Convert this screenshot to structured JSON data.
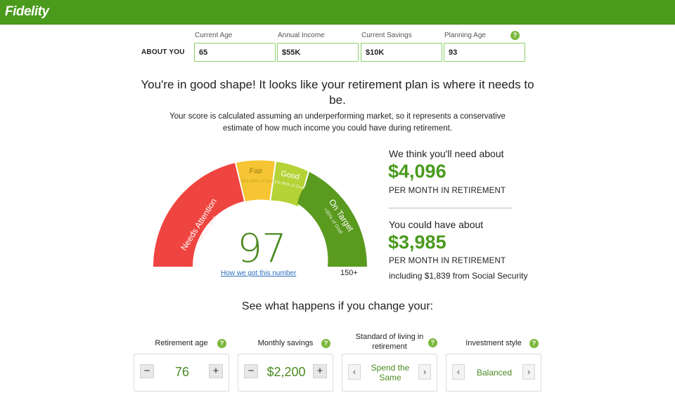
{
  "header": {
    "logo_text": "Fidelity",
    "brand_color": "#4a9a1c"
  },
  "about": {
    "label": "ABOUT YOU",
    "fields": [
      {
        "label": "Current Age",
        "value": "65"
      },
      {
        "label": "Annual Income",
        "value": "$55K"
      },
      {
        "label": "Current Savings",
        "value": "$10K"
      },
      {
        "label": "Planning Age",
        "value": "93"
      }
    ],
    "help_glyph": "?"
  },
  "result": {
    "headline": "You're in good shape! It looks like your retirement plan is where it needs to be.",
    "subtext": "Your score is calculated assuming an underperforming market, so it represents a conservative estimate of how much income you could have during retirement."
  },
  "gauge": {
    "score": "97",
    "link": "How we got this number",
    "max_label": "150+",
    "segments": [
      {
        "title": "Needs Attention",
        "range": "<65% of Goal",
        "color": "#ef4540"
      },
      {
        "title": "Fair",
        "range": "65%-80% of Goal",
        "color": "#f6c533"
      },
      {
        "title": "Good",
        "range": "81%-95% of Goal",
        "color": "#b5d336"
      },
      {
        "title": "On Target",
        "range": ">95% of Goal",
        "color": "#5a9a1e"
      }
    ]
  },
  "need": {
    "intro": "We think you'll need about",
    "amount": "$4,096",
    "sub": "PER MONTH IN RETIREMENT"
  },
  "have": {
    "intro": "You could have about",
    "amount": "$3,985",
    "sub": "PER MONTH IN RETIREMENT",
    "ss": "including $1,839 from Social Security"
  },
  "change": {
    "title": "See what happens if you change your:",
    "controls": [
      {
        "label": "Retirement age",
        "value": "76",
        "minus": "−",
        "plus": "+"
      },
      {
        "label": "Monthly savings",
        "value": "$2,200",
        "minus": "−",
        "plus": "+"
      },
      {
        "label": "Standard of living in retirement",
        "value": "Spend the Same",
        "prev": "‹",
        "next": "›"
      },
      {
        "label": "Investment style",
        "value": "Balanced",
        "prev": "‹",
        "next": "›"
      }
    ]
  }
}
